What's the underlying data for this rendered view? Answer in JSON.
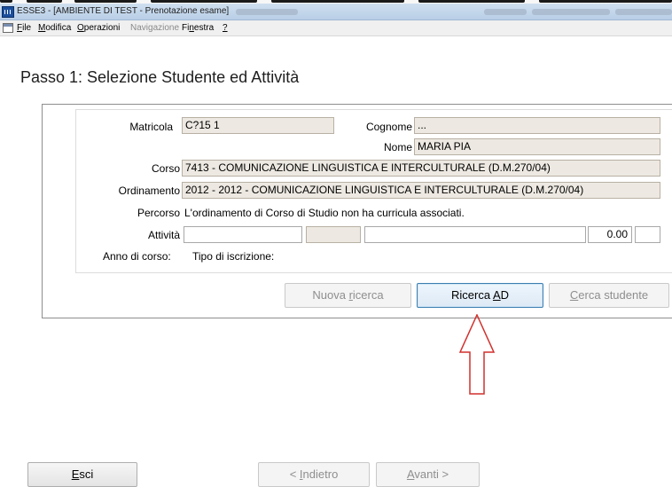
{
  "window": {
    "title": "ESSE3 - [AMBIENTE DI TEST - Prenotazione esame]"
  },
  "menu": {
    "items": [
      {
        "label": "File",
        "enabled": true
      },
      {
        "label": "Modifica",
        "enabled": true
      },
      {
        "label": "Operazioni",
        "enabled": true
      },
      {
        "label": "Navigazione",
        "enabled": false
      },
      {
        "label": "Finestra",
        "enabled": true
      },
      {
        "label": "?",
        "enabled": true
      }
    ]
  },
  "step": {
    "title": "Passo 1: Selezione Studente ed Attività"
  },
  "form": {
    "matricola_label": "Matricola",
    "matricola_value": "C?15 1",
    "cognome_label": "Cognome",
    "cognome_value": "...",
    "nome_label": "Nome",
    "nome_value": "MARIA PIA",
    "corso_label": "Corso",
    "corso_value": "7413 - COMUNICAZIONE LINGUISTICA E INTERCULTURALE (D.M.270/04)",
    "ordinamento_label": "Ordinamento",
    "ordinamento_value": "2012 - 2012 - COMUNICAZIONE LINGUISTICA E INTERCULTURALE (D.M.270/04)",
    "percorso_label": "Percorso",
    "percorso_value": "L'ordinamento di Corso di Studio non ha curricula associati.",
    "attivita_label": "Attività",
    "attivita_value": "0.00",
    "anno_label": "Anno di corso:",
    "tipo_label": "Tipo di iscrizione:"
  },
  "buttons": {
    "nuova_ricerca": "Nuova ricerca",
    "ricerca_ad": "Ricerca AD",
    "cerca_studente": "Cerca studente",
    "esci": "Esci",
    "indietro": "< Indietro",
    "avanti": "Avanti >"
  },
  "colors": {
    "readonly_field": "#ede9e2",
    "arrow": "#d0312d",
    "primary_border": "#3c7fb1"
  }
}
